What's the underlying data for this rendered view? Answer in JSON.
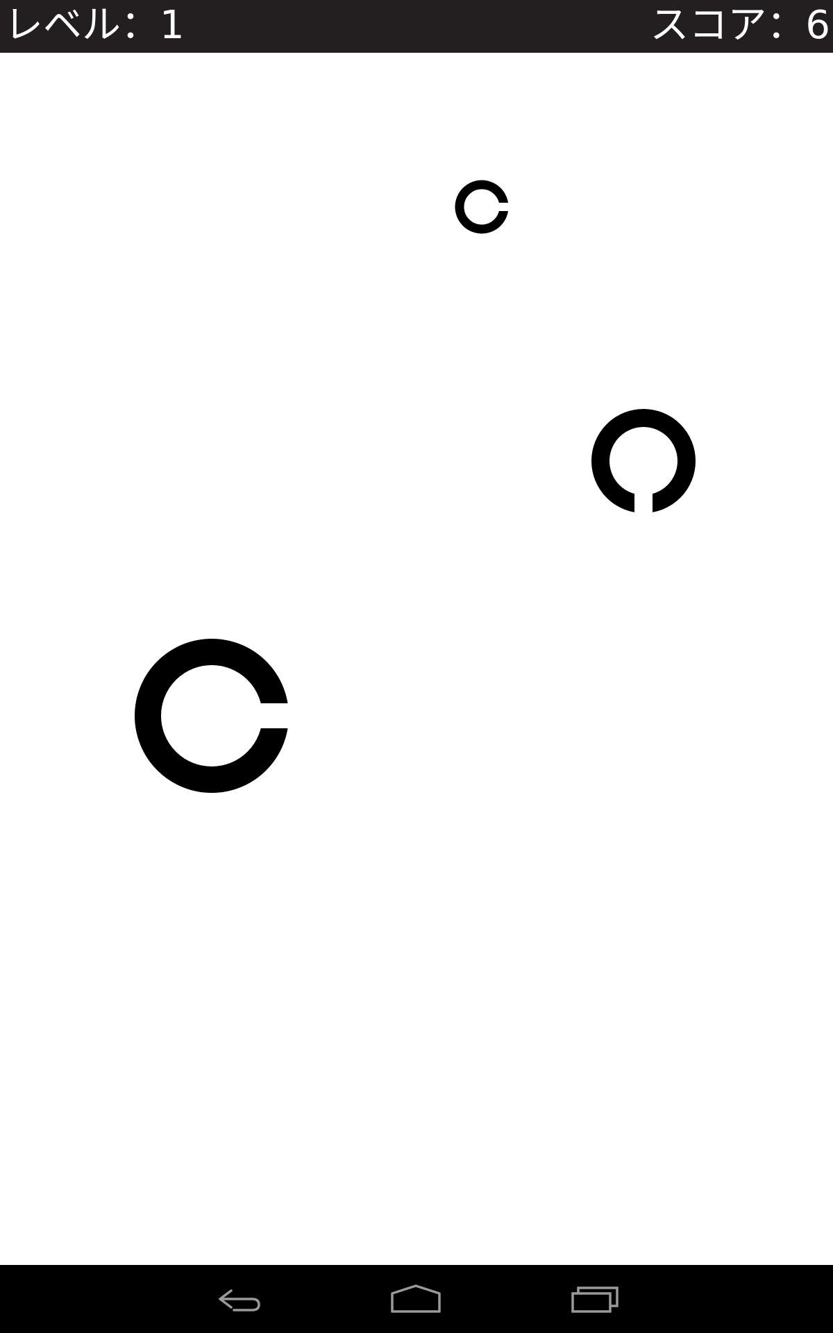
{
  "hud": {
    "level_label": "レベル：1",
    "score_label": "スコア：6"
  },
  "rings": [
    {
      "name": "landolt-ring-small",
      "gap_direction": "right"
    },
    {
      "name": "landolt-ring-medium",
      "gap_direction": "down"
    },
    {
      "name": "landolt-ring-large",
      "gap_direction": "right"
    }
  ],
  "nav": {
    "back_icon": "back-icon",
    "home_icon": "home-icon",
    "recent_icon": "recent-apps-icon"
  },
  "colors": {
    "status_bar": "#231e1f",
    "nav_bar": "#000000",
    "ring": "#000000",
    "nav_icon": "#9a9a9a"
  }
}
